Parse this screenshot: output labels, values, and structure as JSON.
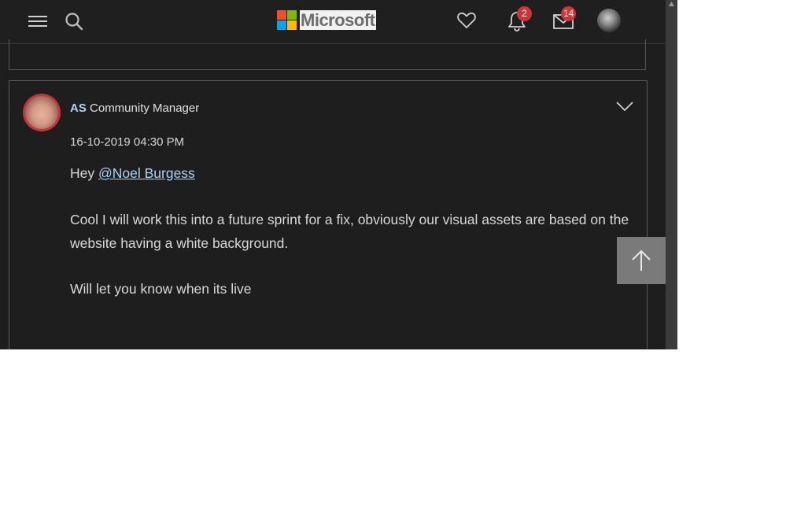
{
  "header": {
    "logo_text": "Microsoft",
    "notifications_count": "2",
    "messages_count": "14",
    "icons": [
      "menu-icon",
      "search-icon",
      "heart-icon",
      "bell-icon",
      "mail-icon"
    ]
  },
  "post": {
    "author_name": "AS",
    "author_role": "Community Manager",
    "date": "16-10-2019 04:30 PM",
    "greeting_prefix": "Hey ",
    "mention": "@Noel Burgess",
    "paragraph1": "Cool I will work this into a future sprint for a fix, obviously our visual assets are based on the website having a white background.",
    "paragraph2": "Will let you know when its live"
  },
  "colors": {
    "background": "#1e1e1e",
    "link": "#a9d3f5",
    "badge": "#d13438",
    "avatar_ring": "#c9323a",
    "logo_red": "#f25022",
    "logo_green": "#7fba00",
    "logo_blue": "#00a4ef",
    "logo_yellow": "#ffb900"
  }
}
